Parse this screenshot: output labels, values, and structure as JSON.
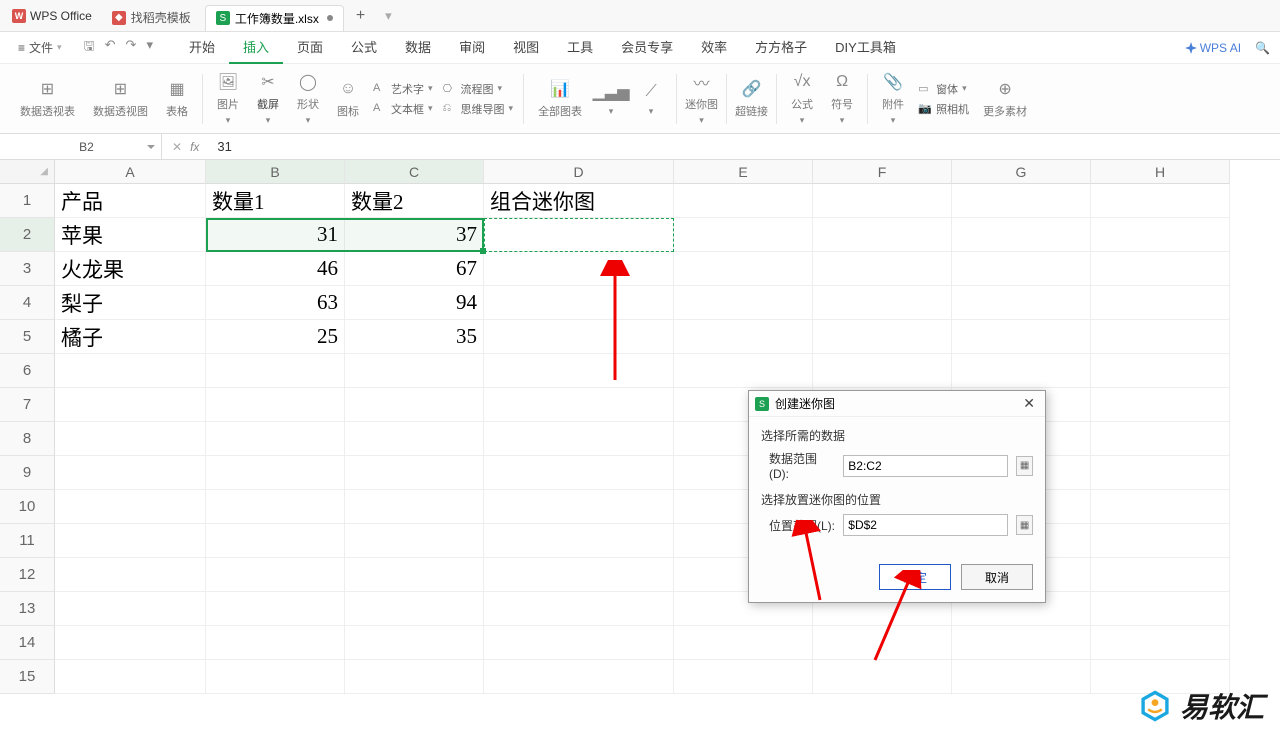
{
  "app": {
    "name": "WPS Office"
  },
  "tabs": [
    {
      "label": "找稻壳模板",
      "icon": "doc-red"
    },
    {
      "label": "工作簿数量.xlsx",
      "icon": "doc-green",
      "active": true
    }
  ],
  "menubar": {
    "file": "文件",
    "items": [
      "开始",
      "插入",
      "页面",
      "公式",
      "数据",
      "审阅",
      "视图",
      "工具",
      "会员专享",
      "效率",
      "方方格子",
      "DIY工具箱"
    ],
    "active": "插入",
    "wps_ai": "WPS AI"
  },
  "ribbon": {
    "pivot_table": "数据透视表",
    "pivot_chart": "数据透视图",
    "table": "表格",
    "picture": "图片",
    "screenshot": "截屏",
    "shapes": "形状",
    "icons": "图标",
    "wordart": "艺术字",
    "textbox": "文本框",
    "flowchart": "流程图",
    "mindmap": "思维导图",
    "all_charts": "全部图表",
    "chart_icons": "",
    "sparkline": "迷你图",
    "hyperlink": "超链接",
    "equation": "公式",
    "symbol": "符号",
    "attachment": "附件",
    "camera": "照相机",
    "form": "窗体",
    "more": "更多素材"
  },
  "formula_bar": {
    "name_box": "B2",
    "value": "31"
  },
  "columns": [
    "A",
    "B",
    "C",
    "D",
    "E",
    "F",
    "G",
    "H"
  ],
  "rows": [
    1,
    2,
    3,
    4,
    5,
    6,
    7,
    8,
    9,
    10,
    11,
    12,
    13,
    14,
    15
  ],
  "grid": {
    "headers": [
      "产品",
      "数量1",
      "数量2",
      "组合迷你图"
    ],
    "data": [
      {
        "a": "苹果",
        "b": "31",
        "c": "37"
      },
      {
        "a": "火龙果",
        "b": "46",
        "c": "67"
      },
      {
        "a": "梨子",
        "b": "63",
        "c": "94"
      },
      {
        "a": "橘子",
        "b": "25",
        "c": "35"
      }
    ]
  },
  "dialog": {
    "title": "创建迷你图",
    "section1": "选择所需的数据",
    "data_range_label": "数据范围(D):",
    "data_range_value": "B2:C2",
    "section2": "选择放置迷你图的位置",
    "location_label": "位置范围(L):",
    "location_value": "$D$2",
    "ok": "确定",
    "cancel": "取消"
  },
  "watermark": "易软汇"
}
